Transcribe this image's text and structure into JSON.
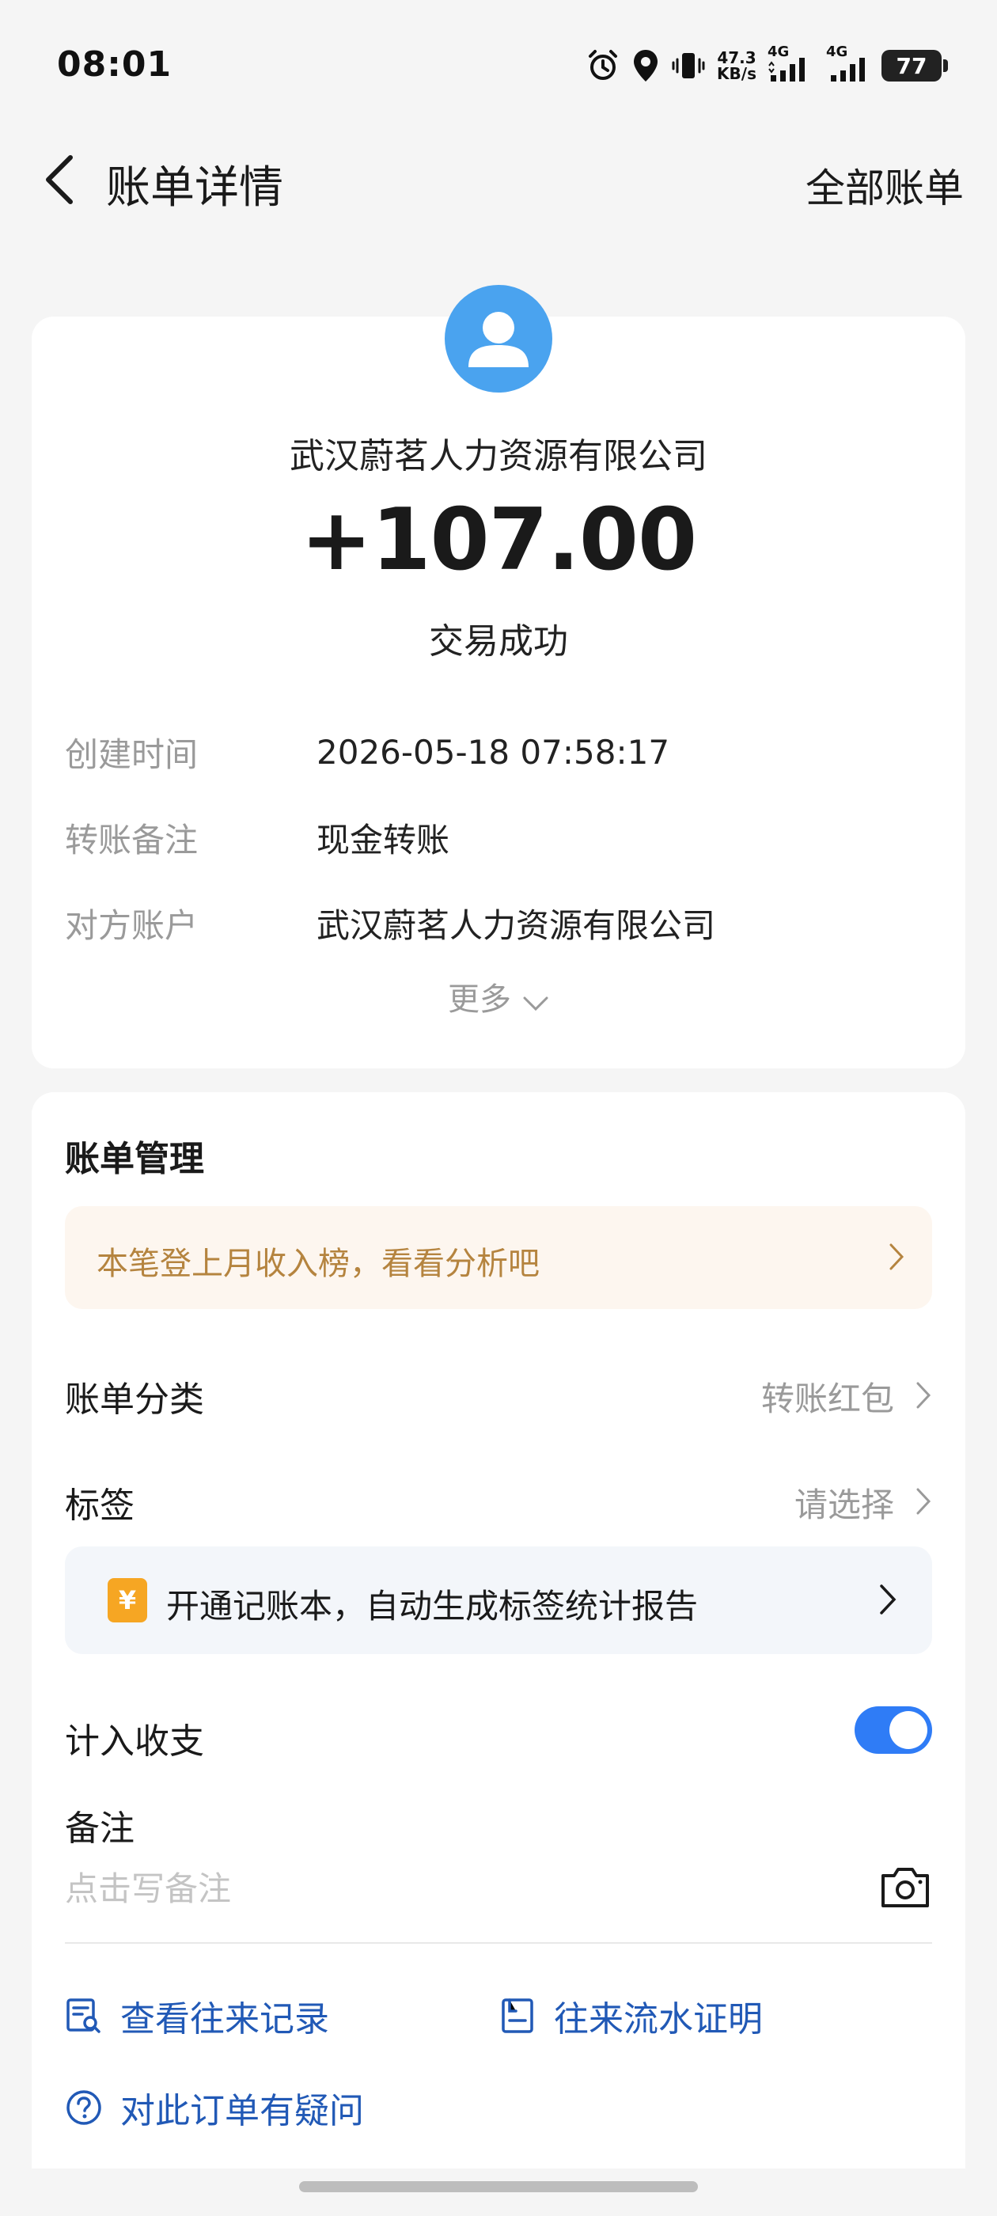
{
  "status_bar": {
    "time": "08:01",
    "speed_value": "47.3",
    "speed_unit": "KB/s",
    "net1": "4G",
    "net2": "4G",
    "battery": "77"
  },
  "nav": {
    "title": "账单详情",
    "right_label": "全部账单"
  },
  "transaction": {
    "payee": "武汉蔚茗人力资源有限公司",
    "amount": "+107.00",
    "status": "交易成功",
    "details": [
      {
        "label": "创建时间",
        "value": "2026-05-18 07:58:17"
      },
      {
        "label": "转账备注",
        "value": "现金转账"
      },
      {
        "label": "对方账户",
        "value": "武汉蔚茗人力资源有限公司"
      }
    ],
    "more_label": "更多"
  },
  "management": {
    "title": "账单管理",
    "promo": "本笔登上月收入榜，看看分析吧",
    "category_label": "账单分类",
    "category_value": "转账红包",
    "tag_label": "标签",
    "tag_value": "请选择",
    "book_banner": "开通记账本，自动生成标签统计报告",
    "book_icon": "¥",
    "include_label": "计入收支",
    "include_on": true,
    "note_label": "备注",
    "note_placeholder": "点击写备注",
    "links": {
      "records": "查看往来记录",
      "proof": "往来流水证明",
      "question": "对此订单有疑问"
    }
  },
  "colors": {
    "accent": "#2f7cf6",
    "link": "#2159b6",
    "avatar": "#4aa3ef",
    "promo_text": "#b5843f"
  }
}
